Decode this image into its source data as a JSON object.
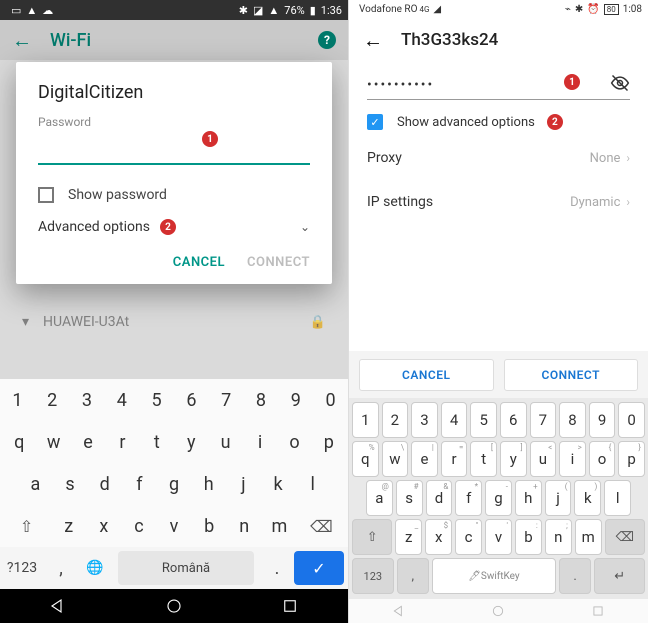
{
  "left": {
    "status": {
      "battery": "76%",
      "time": "1:36"
    },
    "appbar": {
      "title": "Wi-Fi"
    },
    "bg_network": "HUAWEI-U3At",
    "dialog": {
      "ssid": "DigitalCitizen",
      "password_label": "Password",
      "show_password": "Show password",
      "advanced": "Advanced options",
      "cancel": "CANCEL",
      "connect": "CONNECT",
      "badge1": "1",
      "badge2": "2"
    },
    "keyboard": {
      "row1": [
        "1",
        "2",
        "3",
        "4",
        "5",
        "6",
        "7",
        "8",
        "9",
        "0"
      ],
      "row2": [
        "q",
        "w",
        "e",
        "r",
        "t",
        "y",
        "u",
        "i",
        "o",
        "p"
      ],
      "row3": [
        "a",
        "s",
        "d",
        "f",
        "g",
        "h",
        "j",
        "k",
        "l"
      ],
      "row4": [
        "z",
        "x",
        "c",
        "v",
        "b",
        "n",
        "m"
      ],
      "sym": "?123",
      "space": "Română"
    }
  },
  "right": {
    "status": {
      "carrier": "Vodafone RO",
      "time": "1:08",
      "battery": "80"
    },
    "appbar": {
      "title": "Th3G33ks24"
    },
    "password_mask": "••••••••••",
    "show_advanced": "Show advanced options",
    "proxy_label": "Proxy",
    "proxy_value": "None",
    "ip_label": "IP settings",
    "ip_value": "Dynamic",
    "cancel": "CANCEL",
    "connect": "CONNECT",
    "badge1": "1",
    "badge2": "2",
    "keyboard": {
      "row1": [
        "1",
        "2",
        "3",
        "4",
        "5",
        "6",
        "7",
        "8",
        "9",
        "0"
      ],
      "row2": [
        "q",
        "w",
        "e",
        "r",
        "t",
        "y",
        "u",
        "i",
        "o",
        "p"
      ],
      "hints2": [
        "%",
        "\\",
        "|",
        "=",
        "[",
        "]",
        "<",
        ">",
        "{",
        "}"
      ],
      "row3": [
        "a",
        "s",
        "d",
        "f",
        "g",
        "h",
        "j",
        "k",
        "l"
      ],
      "hints3": [
        "@",
        "#",
        "&",
        "*",
        "-",
        "+",
        "(",
        ")",
        ""
      ],
      "row4": [
        "z",
        "x",
        "c",
        "v",
        "b",
        "n",
        "m"
      ],
      "hints4": [
        "_",
        "$",
        "\"",
        "'",
        ":",
        ";",
        ""
      ],
      "sym": "123",
      "space": "SwiftKey"
    }
  }
}
